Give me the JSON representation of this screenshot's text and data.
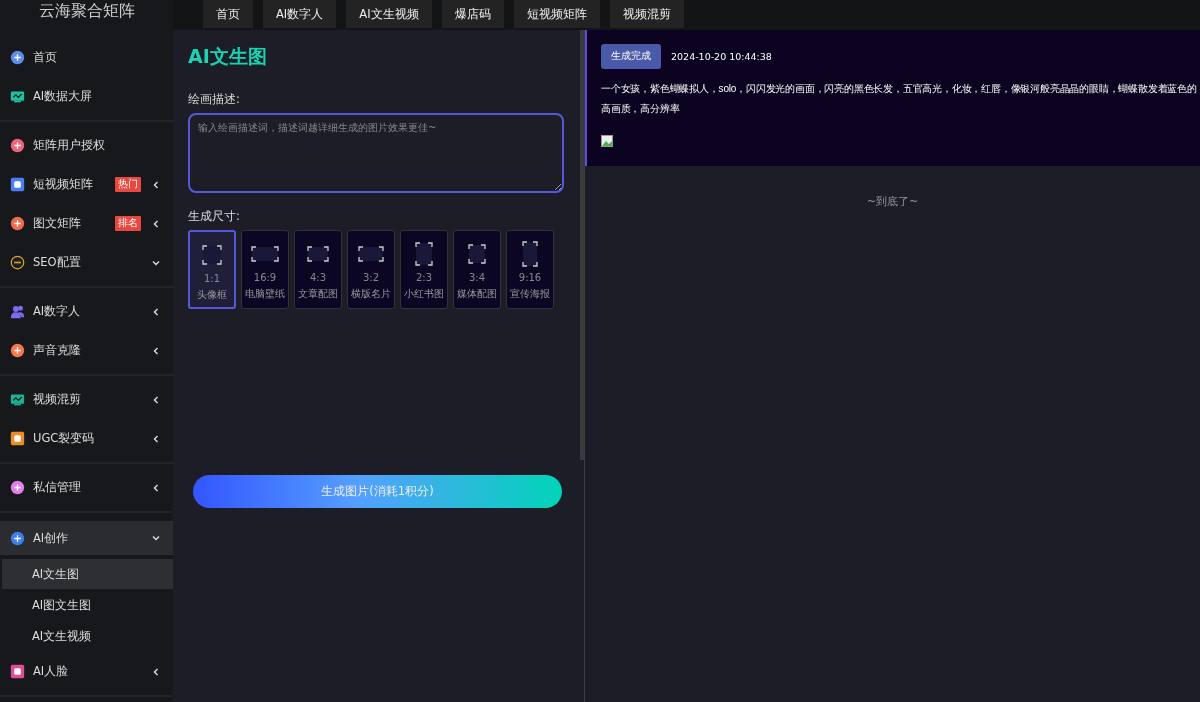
{
  "app": {
    "title": "云海聚合矩阵"
  },
  "sidebar": {
    "groups": [
      {
        "items": [
          {
            "label": "首页",
            "has_arrow": false
          },
          {
            "label": "AI数据大屏",
            "has_arrow": false
          }
        ]
      },
      {
        "items": [
          {
            "label": "矩阵用户授权",
            "has_arrow": false
          },
          {
            "label": "短视频矩阵",
            "badge": "热门",
            "expanded": false,
            "has_arrow": true
          },
          {
            "label": "图文矩阵",
            "badge": "排名",
            "expanded": false,
            "has_arrow": true
          },
          {
            "label": "SEO配置",
            "expanded": true,
            "has_arrow": true
          }
        ]
      },
      {
        "items": [
          {
            "label": "AI数字人",
            "expanded": false,
            "has_arrow": true
          },
          {
            "label": "声音克隆",
            "expanded": false,
            "has_arrow": true
          }
        ]
      },
      {
        "items": [
          {
            "label": "视频混剪",
            "expanded": false,
            "has_arrow": true
          },
          {
            "label": "UGC裂变码",
            "expanded": false,
            "has_arrow": true
          }
        ]
      },
      {
        "items": [
          {
            "label": "私信管理",
            "expanded": false,
            "has_arrow": true
          }
        ]
      },
      {
        "items": [
          {
            "label": "AI创作",
            "expanded": true,
            "has_arrow": true,
            "children": [
              {
                "label": "AI文生图",
                "selected": true
              },
              {
                "label": "AI图文生图",
                "selected": false
              },
              {
                "label": "AI文生视频",
                "selected": false
              }
            ]
          },
          {
            "label": "AI人脸",
            "expanded": false,
            "has_arrow": true
          }
        ]
      }
    ]
  },
  "tabs": [
    {
      "label": "首页",
      "selected": false
    },
    {
      "label": "AI数字人",
      "selected": false
    },
    {
      "label": "AI文生视频",
      "selected": false
    },
    {
      "label": "爆店码",
      "selected": false
    },
    {
      "label": "短视频矩阵",
      "selected": false
    },
    {
      "label": "视频混剪",
      "selected": false
    }
  ],
  "form": {
    "title": "AI文生图",
    "description_label": "绘画描述:",
    "description": {
      "placeholder": "输入绘画描述词，描述词越详细生成的图片效果更佳~"
    },
    "size_label": "生成尺寸:",
    "sizes": [
      {
        "ratio": "1:1",
        "label": "头像框",
        "selected": true
      },
      {
        "ratio": "16:9",
        "label": "电脑壁纸",
        "selected": false
      },
      {
        "ratio": "4:3",
        "label": "文章配图",
        "selected": false
      },
      {
        "ratio": "3:2",
        "label": "横版名片",
        "selected": false
      },
      {
        "ratio": "2:3",
        "label": "小红书图",
        "selected": false
      },
      {
        "ratio": "3:4",
        "label": "媒体配图",
        "selected": false
      },
      {
        "ratio": "9:16",
        "label": "宣传海报",
        "selected": false
      }
    ],
    "submit": "生成图片(消耗1积分)"
  },
  "results": [
    {
      "status": "生成完成",
      "time": "2024-10-20 10:44:38",
      "prompt_lines": [
        "一个女孩，紫色蝴蝶拟人，solo，闪闪发光的画面，闪亮的黑色长发，五官高光，化妆，红唇，像银河般亮晶晶的眼睛，蝴蝶散发着蓝色的",
        "高画质，高分辨率"
      ]
    }
  ],
  "end_note": "~到底了~"
}
